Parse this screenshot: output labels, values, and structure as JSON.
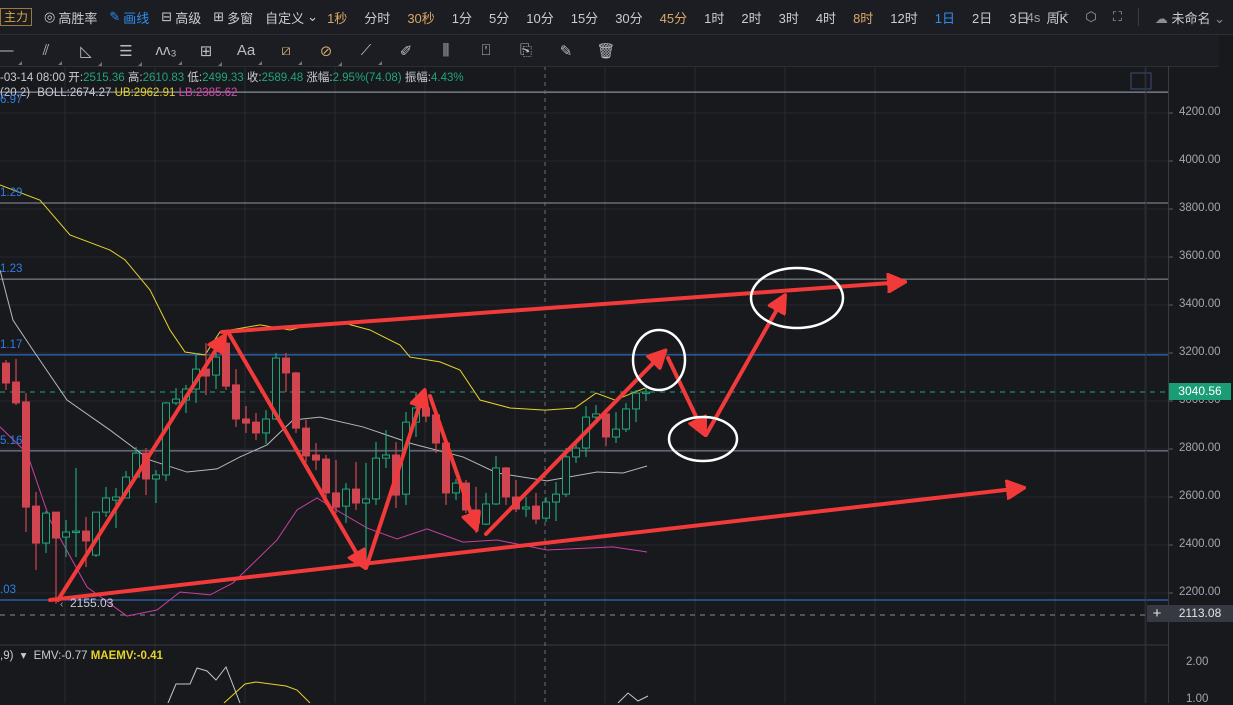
{
  "toolbar": {
    "badge": "主力",
    "items": [
      {
        "icon": "target-icon",
        "glyph": "◎",
        "label": "高胜率"
      },
      {
        "icon": "pencil-icon",
        "glyph": "✎",
        "label": "画线"
      },
      {
        "icon": "box-icon",
        "glyph": "⊟",
        "label": "高级"
      },
      {
        "icon": "multi-window-icon",
        "glyph": "⊞",
        "label": "多窗"
      }
    ],
    "custom_label": "自定义",
    "custom_chevron": "⌄",
    "timeframes": [
      {
        "label": "1秒",
        "style": "gold"
      },
      {
        "label": "分时",
        "style": ""
      },
      {
        "label": "30秒",
        "style": "gold"
      },
      {
        "label": "1分",
        "style": ""
      },
      {
        "label": "5分",
        "style": ""
      },
      {
        "label": "10分",
        "style": ""
      },
      {
        "label": "15分",
        "style": ""
      },
      {
        "label": "30分",
        "style": ""
      },
      {
        "label": "45分",
        "style": "gold"
      },
      {
        "label": "1时",
        "style": ""
      },
      {
        "label": "2时",
        "style": ""
      },
      {
        "label": "3时",
        "style": ""
      },
      {
        "label": "4时",
        "style": ""
      },
      {
        "label": "8时",
        "style": "gold"
      },
      {
        "label": "12时",
        "style": ""
      },
      {
        "label": "1日",
        "style": "active"
      },
      {
        "label": "2日",
        "style": ""
      },
      {
        "label": "3日",
        "style": ""
      },
      {
        "label": "周K",
        "style": ""
      }
    ],
    "refresh": "4s",
    "layout_name": "未命名",
    "layout_chevron": "⌄"
  },
  "drawing_tools": [
    {
      "name": "horizontal-ray-tool-icon",
      "glyph": "—"
    },
    {
      "name": "parallel-lines-tool-icon",
      "glyph": "⫽"
    },
    {
      "name": "triangle-tool-icon",
      "glyph": "◺"
    },
    {
      "name": "fibonacci-tool-icon",
      "glyph": "☰"
    },
    {
      "name": "wave-tool-icon",
      "glyph": "ʌʌ₃"
    },
    {
      "name": "rectangle-tool-icon",
      "glyph": "⊞"
    },
    {
      "name": "text-tool-icon",
      "glyph": "Aa"
    },
    {
      "name": "magnet-tool-icon",
      "glyph": "⧄"
    },
    {
      "name": "magnet-off-tool-icon",
      "glyph": "⊘"
    },
    {
      "name": "ruler-tool-icon",
      "glyph": "⟋"
    },
    {
      "name": "brush-tool-icon",
      "glyph": "✐"
    },
    {
      "name": "candles-tool-icon",
      "glyph": "⫼"
    },
    {
      "name": "lock-tool-icon",
      "glyph": "⍞"
    },
    {
      "name": "bookmark-tool-icon",
      "glyph": "⎘"
    },
    {
      "name": "edit-tool-icon",
      "glyph": "✎"
    },
    {
      "name": "trash-tool-icon",
      "glyph": "🗑"
    }
  ],
  "info": {
    "date": "-03-14 08:00",
    "open_label": "开:",
    "open": "2515.36",
    "high_label": "高:",
    "high": "2610.83",
    "low_label": "低:",
    "low": "2499.33",
    "close_label": "收:",
    "close": "2589.48",
    "change_label": "涨幅:",
    "change": "2.95%(74.08)",
    "amp_label": "振幅:",
    "amp": "4.43%"
  },
  "boll": {
    "params": "(20,2)",
    "mid": "BOLL:2674.27",
    "ub": "UB:2962.91",
    "lb": "LB:2385.62"
  },
  "emv": {
    "params": ",9)",
    "dropdown": "▾",
    "emv": "EMV:-0.77",
    "maemv": "MAEMV:-0.41"
  },
  "colors": {
    "up": "#1fa57a",
    "down": "#d14550",
    "ub": "#e6d32a",
    "mid": "#b5b7bd",
    "lb": "#c8409f",
    "fib": "#2f7ee6",
    "drawing": "#f23a3a",
    "current_price": "#1a9d74"
  },
  "fib_levels": [
    {
      "label": "6.97",
      "price": 4287
    },
    {
      "label": "1.29",
      "price": 3825
    },
    {
      "label": "1.23",
      "price": 3508
    },
    {
      "label": "1.17",
      "price": 3192
    },
    {
      "label": "5.16",
      "price": 2792
    },
    {
      "label": ".03",
      "price": 2171
    }
  ],
  "low_marker": {
    "arrow": "‹",
    "label": "2155.03",
    "price": 2155.03
  },
  "current_price": {
    "label": "3040.56",
    "price": 3040.56
  },
  "crosshair_price": {
    "plus": "+",
    "label": "2113.08",
    "price": 2113.08
  },
  "emv_axis": [
    "2.00",
    "1.00"
  ],
  "chart_data": {
    "type": "candlestick",
    "title": "",
    "ylim": [
      2100,
      4290
    ],
    "y_ticks": [
      "4200.00",
      "4000.00",
      "3800.00",
      "3600.00",
      "3400.00",
      "3200.00",
      "3000.00",
      "2800.00",
      "2600.00",
      "2400.00",
      "2200.00"
    ],
    "y_tick_values": [
      4200,
      4000,
      3800,
      3600,
      3400,
      3200,
      3000,
      2800,
      2600,
      2400,
      2200
    ],
    "ohlc": [
      [
        3158,
        3171,
        3046,
        3075
      ],
      [
        3079,
        3175,
        2983,
        2992
      ],
      [
        2996,
        3033,
        2454,
        2558
      ],
      [
        2562,
        2621,
        2296,
        2408
      ],
      [
        2408,
        2542,
        2367,
        2533
      ],
      [
        2537,
        2537,
        2155,
        2429
      ],
      [
        2433,
        2504,
        2350,
        2454
      ],
      [
        2454,
        2721,
        2350,
        2458
      ],
      [
        2458,
        2517,
        2308,
        2417
      ],
      [
        2358,
        2537,
        2350,
        2537
      ],
      [
        2537,
        2642,
        2517,
        2596
      ],
      [
        2587,
        2637,
        2471,
        2600
      ],
      [
        2596,
        2708,
        2596,
        2683
      ],
      [
        2683,
        2808,
        2683,
        2783
      ],
      [
        2783,
        2804,
        2608,
        2675
      ],
      [
        2675,
        2712,
        2575,
        2692
      ],
      [
        2692,
        2996,
        2667,
        2992
      ],
      [
        2992,
        3054,
        2983,
        3008
      ],
      [
        3004,
        3067,
        2950,
        3050
      ],
      [
        3050,
        3200,
        2992,
        3133
      ],
      [
        3133,
        3241,
        3025,
        3104
      ],
      [
        3108,
        3220,
        3050,
        3183
      ],
      [
        3241,
        3287,
        3046,
        3062
      ],
      [
        3067,
        3133,
        2892,
        2925
      ],
      [
        2925,
        2979,
        2867,
        2908
      ],
      [
        2912,
        2950,
        2837,
        2867
      ],
      [
        2867,
        2962,
        2821,
        2925
      ],
      [
        2925,
        3200,
        2921,
        3179
      ],
      [
        3179,
        3200,
        3037,
        3117
      ],
      [
        3117,
        3121,
        2867,
        2887
      ],
      [
        2887,
        2921,
        2746,
        2771
      ],
      [
        2775,
        2825,
        2712,
        2754
      ],
      [
        2758,
        2775,
        2567,
        2617
      ],
      [
        2617,
        2754,
        2533,
        2558
      ],
      [
        2562,
        2658,
        2492,
        2633
      ],
      [
        2633,
        2746,
        2546,
        2575
      ],
      [
        2575,
        2742,
        2308,
        2592
      ],
      [
        2592,
        2829,
        2567,
        2762
      ],
      [
        2762,
        2879,
        2721,
        2775
      ],
      [
        2775,
        2829,
        2554,
        2608
      ],
      [
        2612,
        2954,
        2567,
        2912
      ],
      [
        2912,
        3037,
        2850,
        2971
      ],
      [
        2971,
        3037,
        2912,
        2937
      ],
      [
        2942,
        2942,
        2783,
        2825
      ],
      [
        2825,
        2829,
        2567,
        2617
      ],
      [
        2617,
        2675,
        2587,
        2658
      ],
      [
        2658,
        2671,
        2533,
        2546
      ],
      [
        2546,
        2642,
        2450,
        2492
      ],
      [
        2487,
        2617,
        2483,
        2571
      ],
      [
        2571,
        2771,
        2567,
        2721
      ],
      [
        2721,
        2725,
        2567,
        2600
      ],
      [
        2600,
        2671,
        2537,
        2550
      ],
      [
        2550,
        2600,
        2517,
        2558
      ],
      [
        2562,
        2617,
        2487,
        2508
      ],
      [
        2512,
        2600,
        2496,
        2579
      ],
      [
        2579,
        2662,
        2500,
        2612
      ],
      [
        2612,
        2804,
        2600,
        2767
      ],
      [
        2767,
        2829,
        2742,
        2804
      ],
      [
        2804,
        2979,
        2767,
        2933
      ],
      [
        2933,
        2983,
        2921,
        2946
      ],
      [
        2946,
        2950,
        2812,
        2850
      ],
      [
        2850,
        2954,
        2825,
        2883
      ],
      [
        2883,
        2992,
        2871,
        2967
      ],
      [
        2967,
        3046,
        2912,
        3033
      ],
      [
        3033,
        3058,
        3000,
        3037
      ]
    ],
    "boll_upper": [
      [
        -0.6,
        3900
      ],
      [
        3.4,
        3837
      ],
      [
        6.4,
        3692
      ],
      [
        10.4,
        3629
      ],
      [
        11.9,
        3588
      ],
      [
        14.4,
        3463
      ],
      [
        16.4,
        3296
      ],
      [
        17.9,
        3204
      ],
      [
        19.9,
        3192
      ],
      [
        21.4,
        3288
      ],
      [
        25.4,
        3317
      ],
      [
        28.4,
        3296
      ],
      [
        30.4,
        3317
      ],
      [
        33.4,
        3329
      ],
      [
        36.4,
        3296
      ],
      [
        39.4,
        3233
      ],
      [
        40.4,
        3183
      ],
      [
        43.4,
        3163
      ],
      [
        45.4,
        3129
      ],
      [
        47.4,
        3004
      ],
      [
        50.4,
        2971
      ],
      [
        53.9,
        2962
      ],
      [
        56.9,
        2971
      ],
      [
        59,
        3033
      ],
      [
        60.9,
        3004
      ],
      [
        63.9,
        3054
      ]
    ],
    "boll_mid": [
      [
        -0.6,
        3546
      ],
      [
        0.7,
        3337
      ],
      [
        2.7,
        3212
      ],
      [
        6.1,
        3004
      ],
      [
        10.4,
        2879
      ],
      [
        14.4,
        2754
      ],
      [
        18.1,
        2704
      ],
      [
        21.1,
        2717
      ],
      [
        23.4,
        2767
      ],
      [
        26.1,
        2817
      ],
      [
        28.7,
        2921
      ],
      [
        31.4,
        2933
      ],
      [
        35.7,
        2892
      ],
      [
        40.7,
        2821
      ],
      [
        45.7,
        2767
      ],
      [
        49.1,
        2700
      ],
      [
        54.1,
        2667
      ],
      [
        59.1,
        2704
      ],
      [
        61.7,
        2700
      ],
      [
        64.1,
        2729
      ]
    ],
    "boll_lower": [
      [
        -0.6,
        2892
      ],
      [
        2.1,
        2783
      ],
      [
        4.4,
        2504
      ],
      [
        8.1,
        2225
      ],
      [
        12.1,
        2104
      ],
      [
        15.1,
        2129
      ],
      [
        17.4,
        2204
      ],
      [
        20.4,
        2192
      ],
      [
        22.7,
        2242
      ],
      [
        27.1,
        2421
      ],
      [
        29.1,
        2546
      ],
      [
        31.1,
        2596
      ],
      [
        33.4,
        2537
      ],
      [
        36.1,
        2471
      ],
      [
        39.1,
        2425
      ],
      [
        42.1,
        2467
      ],
      [
        45.7,
        2412
      ],
      [
        49.1,
        2421
      ],
      [
        54.1,
        2379
      ],
      [
        60.7,
        2392
      ],
      [
        64.1,
        2371
      ]
    ]
  }
}
